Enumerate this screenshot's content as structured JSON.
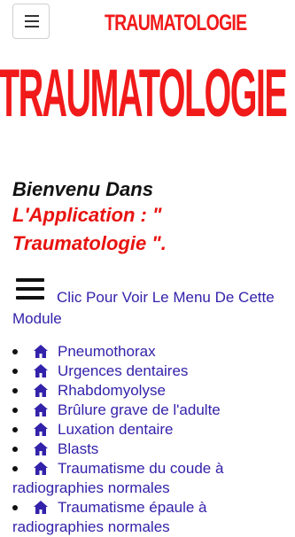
{
  "topbar": {
    "menu_icon": "hamburger-icon",
    "title": "TRAUMATOLOGIE"
  },
  "banner": {
    "title": "TRAUMATOLOGIE"
  },
  "welcome": {
    "line1": "Bienvenu Dans",
    "line2": "L'Application :   \"",
    "line3": "Traumatologie \"."
  },
  "menu_link": {
    "icon": "hamburger-icon",
    "label": "Clic Pour Voir Le Menu De Cette Module"
  },
  "modules": {
    "icon": "home-icon",
    "items": [
      "Pneumothorax",
      "Urgences dentaires",
      "Rhabdomyolyse",
      "Brûlure grave de l'adulte",
      "Luxation dentaire",
      "Blasts",
      "Traumatisme du coude à radiographies normales",
      "Traumatisme épaule à radiographies normales"
    ]
  },
  "colors": {
    "title_red": "#f11a1a",
    "link_blue": "#3322aa"
  }
}
